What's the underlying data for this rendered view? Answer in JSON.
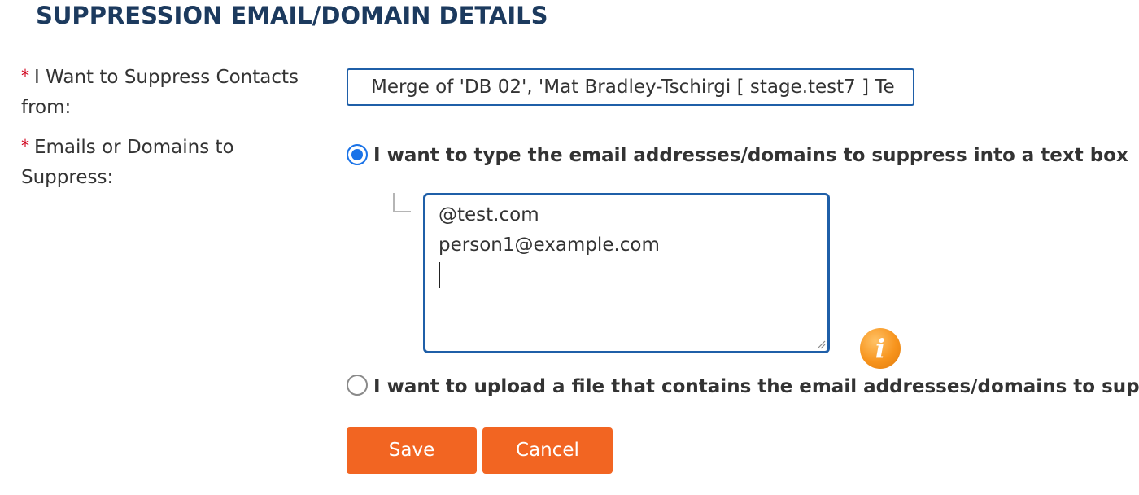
{
  "section": {
    "title": "SUPPRESSION EMAIL/DOMAIN DETAILS"
  },
  "fields": {
    "suppress_from": {
      "required_marker": "*",
      "label": "I Want to Suppress Contacts from:",
      "selected_value": "Merge of 'DB 02', 'Mat Bradley-Tschirgi [ stage.test7 ] Te"
    },
    "emails_domains": {
      "required_marker": "*",
      "label": "Emails or Domains to Suppress:"
    }
  },
  "options": {
    "type_into_box": {
      "label": "I want to type the email addresses/domains to suppress into a text box",
      "selected": true
    },
    "upload_file": {
      "label": "I want to upload a file that contains the email addresses/domains to sup",
      "selected": false
    }
  },
  "textarea": {
    "lines": [
      "@test.com",
      "person1@example.com"
    ]
  },
  "icons": {
    "info": "info-icon",
    "info_glyph": "i",
    "accent_color": "#f7941d"
  },
  "buttons": {
    "save_label": "Save",
    "cancel_label": "Cancel",
    "color": "#f26522"
  },
  "colors": {
    "title": "#1c3a5e",
    "focus_border": "#1f5fa8",
    "radio_selected": "#1a73e8",
    "required": "#d0021b"
  }
}
